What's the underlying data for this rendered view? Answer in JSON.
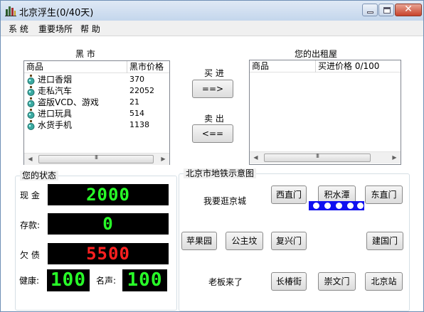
{
  "window": {
    "title": "北京浮生(0/40天)"
  },
  "menu": [
    "系 统",
    "重要场所",
    "帮 助"
  ],
  "black_market": {
    "title": "黑   市",
    "col_item": "商品",
    "col_price": "黑市价格",
    "items": [
      {
        "name": "进口香烟",
        "price": "370"
      },
      {
        "name": "走私汽车",
        "price": "22052"
      },
      {
        "name": "盗版VCD、游戏",
        "price": "21"
      },
      {
        "name": "进口玩具",
        "price": "514"
      },
      {
        "name": "水货手机",
        "price": "1138"
      }
    ]
  },
  "rental": {
    "title": "您的出租屋",
    "col_item": "商品",
    "col_price": "买进价格 0/100"
  },
  "trade": {
    "buy_label": "买 进",
    "buy_button": "==>",
    "sell_label": "卖 出",
    "sell_button": "<=="
  },
  "status": {
    "title": "您的状态",
    "cash_label": "现 金",
    "cash_value": "2000",
    "deposit_label": "存款:",
    "deposit_value": "0",
    "debt_label": "欠 债",
    "debt_value": "5500",
    "health_label": "健康:",
    "health_value": "100",
    "fame_label": "名声:",
    "fame_value": "100"
  },
  "subway": {
    "title": "北京市地铁示意图",
    "hint1": "我要逛京城",
    "hint2": "老板来了",
    "stations": [
      "西直门",
      "积水潭",
      "东直门",
      "苹果园",
      "公主坟",
      "复兴门",
      "建国门",
      "长椿街",
      "崇文门",
      "北京站"
    ]
  },
  "colors": {
    "led_green": "#28ff28",
    "led_red": "#ff2020",
    "subway_line": "#1010f0"
  },
  "icons": {
    "app": "building-icon",
    "item": "gourd-icon"
  }
}
